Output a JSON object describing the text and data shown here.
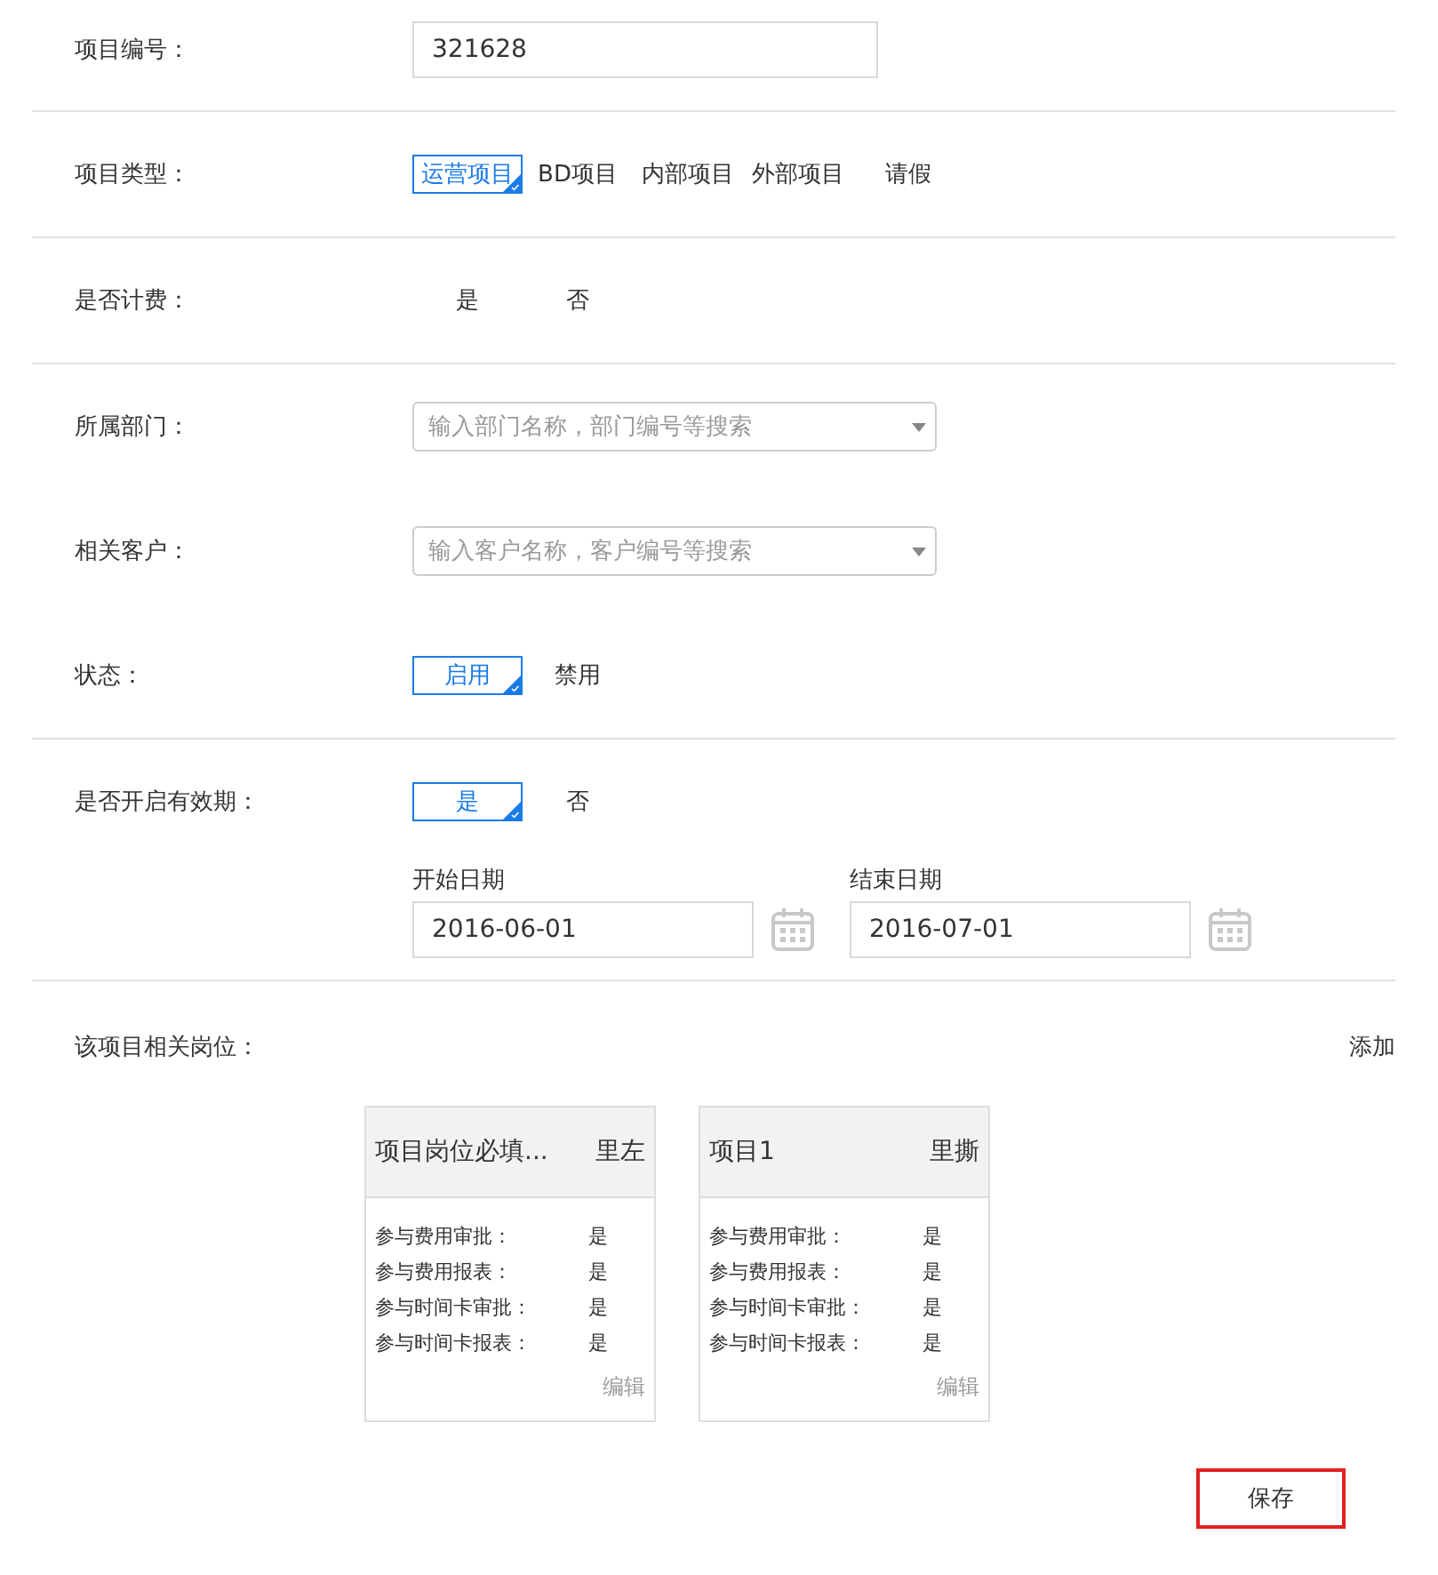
{
  "sections": [
    {
      "fields": [
        {
          "kind": "input",
          "label": "项目编号：",
          "value": "321628"
        }
      ]
    },
    {
      "fields": [
        {
          "kind": "options",
          "label": "项目类型：",
          "options": [
            {
              "label": "运营项目",
              "selected": true
            },
            {
              "label": "BD项目",
              "selected": false
            },
            {
              "label": "内部项目",
              "selected": false
            },
            {
              "label": "外部项目",
              "selected": false
            },
            {
              "label": "请假",
              "selected": false
            }
          ]
        }
      ]
    },
    {
      "fields": [
        {
          "kind": "options",
          "label": "是否计费：",
          "options": [
            {
              "label": "是",
              "selected": false
            },
            {
              "label": "否",
              "selected": false
            }
          ]
        }
      ]
    },
    {
      "fields": [
        {
          "kind": "select",
          "label": "所属部门：",
          "placeholder": "输入部门名称，部门编号等搜索"
        },
        {
          "kind": "select",
          "label": "相关客户：",
          "placeholder": "输入客户名称，客户编号等搜索"
        },
        {
          "kind": "options",
          "label": "状态：",
          "options": [
            {
              "label": "启用",
              "selected": true
            },
            {
              "label": "禁用",
              "selected": false
            }
          ]
        }
      ]
    },
    {
      "fields": [
        {
          "kind": "options",
          "label": "是否开启有效期：",
          "options": [
            {
              "label": "是",
              "selected": true
            },
            {
              "label": "否",
              "selected": false
            }
          ]
        },
        {
          "kind": "dates",
          "dates": [
            {
              "label": "开始日期",
              "value": "2016-06-01"
            },
            {
              "label": "结束日期",
              "value": "2016-07-01"
            }
          ]
        }
      ]
    }
  ],
  "positions": {
    "label": "该项目相关岗位：",
    "add": "添加",
    "cards": [
      {
        "title": "项目岗位必填...",
        "person": "里左",
        "rows": [
          {
            "label": "参与费用审批：",
            "value": "是"
          },
          {
            "label": "参与费用报表：",
            "value": "是"
          },
          {
            "label": "参与时间卡审批：",
            "value": "是"
          },
          {
            "label": "参与时间卡报表：",
            "value": "是"
          }
        ],
        "edit": "编辑"
      },
      {
        "title": "项目1",
        "person": "里撕",
        "rows": [
          {
            "label": "参与费用审批：",
            "value": "是"
          },
          {
            "label": "参与费用报表：",
            "value": "是"
          },
          {
            "label": "参与时间卡审批：",
            "value": "是"
          },
          {
            "label": "参与时间卡报表：",
            "value": "是"
          }
        ],
        "edit": "编辑"
      }
    ]
  },
  "save": "保存"
}
